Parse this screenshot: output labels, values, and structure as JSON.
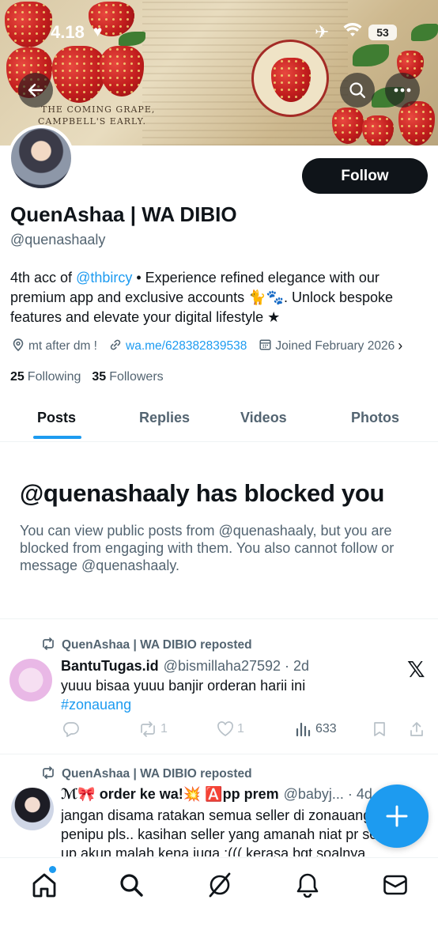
{
  "status_bar": {
    "time": "4.18",
    "battery": "53"
  },
  "banner": {
    "caption_line1": "THE COMING GRAPE,",
    "caption_line2": "CAMPBELL'S EARLY."
  },
  "profile": {
    "display_name": "QuenAshaa | WA DIBIO",
    "handle": "@quenashaaly",
    "follow_label": "Follow",
    "bio_prefix": "4th acc of ",
    "bio_mention": "@thbircy",
    "bio_rest": " • Experience refined elegance with our premium app and exclusive accounts 🐈🐾. Unlock bespoke features and elevate your digital lifestyle ★",
    "location": "mt after dm !",
    "website": "wa.me/628382839538",
    "joined": "Joined February 2026",
    "following_count": "25",
    "following_label": "Following",
    "followers_count": "35",
    "followers_label": "Followers"
  },
  "tabs": [
    "Posts",
    "Replies",
    "Videos",
    "Photos"
  ],
  "active_tab": "Posts",
  "blocked": {
    "title": "@quenashaaly has blocked you",
    "text": "You can view public posts from @quenashaaly, but you are blocked from engaging with them. You also cannot follow or message @quenashaaly."
  },
  "posts": [
    {
      "repost_label": "QuenAshaa | WA DIBIO reposted",
      "author": "BantuTugas.id",
      "handle_time": "@bismillaha27592 · 2d",
      "text": "yuuu bisaa yuuu banjir orderan harii ini",
      "hashtag": "#zonauang",
      "retweets": "1",
      "likes": "1",
      "views": "633"
    },
    {
      "repost_label": "QuenAshaa | WA DIBIO reposted",
      "author": "ℳ🎀 order ke wa!💥 🅰️pp prem",
      "handle_time": "@babyj... · 4d",
      "text": "jangan disama ratakan semua seller di zonauang penipu pls.. kasihan seller yang amanah niat pr set up akun malah kena juga :((( kerasa bgt soalnya"
    }
  ],
  "colors": {
    "accent": "#1d9bf0",
    "text": "#0f1419",
    "muted": "#536471"
  }
}
